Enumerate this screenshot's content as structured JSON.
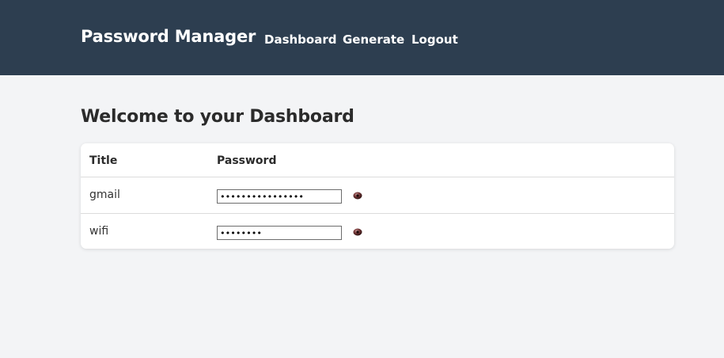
{
  "navbar": {
    "brand": "Password Manager",
    "links": [
      {
        "label": "Dashboard"
      },
      {
        "label": "Generate"
      },
      {
        "label": "Logout"
      }
    ],
    "background_color": "#2d3e50"
  },
  "main": {
    "title": "Welcome to your Dashboard",
    "table": {
      "columns": [
        "Title",
        "Password"
      ],
      "rows": [
        {
          "title": "gmail",
          "password_masked": "••••••••••••••••",
          "icon": "eye-icon"
        },
        {
          "title": "wifi",
          "password_masked": "••••••••",
          "icon": "eye-icon"
        }
      ]
    }
  }
}
